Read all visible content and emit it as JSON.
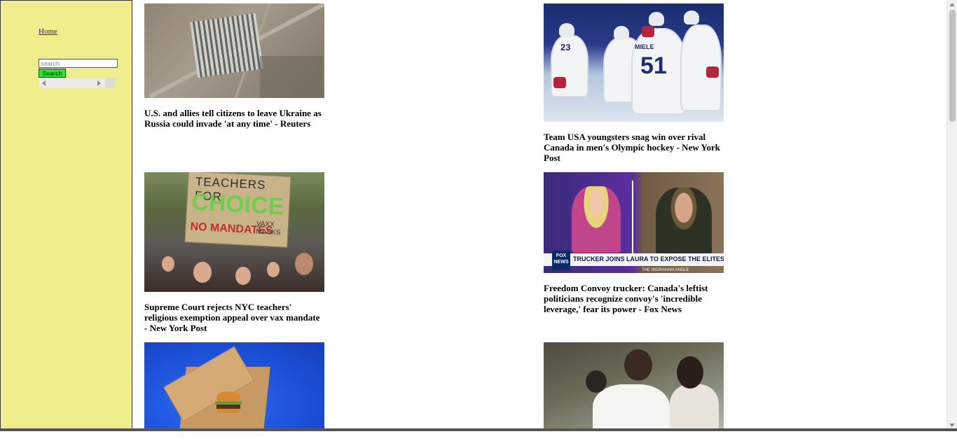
{
  "sidebar": {
    "home_link": "Home",
    "search": {
      "placeholder": "search",
      "button_label": "Search"
    }
  },
  "articles": [
    {
      "headline": "U.S. and allies tell citizens to leave Ukraine as Russia could invade 'at any time' - Reuters"
    },
    {
      "headline": "Team USA youngsters snag win over rival Canada in men's Olympic hockey - New York Post",
      "image_text": {
        "jersey_name": "MIELE",
        "jersey_number_a": "23",
        "jersey_number_b": "51"
      }
    },
    {
      "headline": "Supreme Court rejects NYC teachers' religious exemption appeal over vax mandate - New York Post",
      "image_text": {
        "sign_line1": "TEACHERS FOR",
        "sign_line2": "CHOICE",
        "sign_line3": "NO MANDATES",
        "sign_line4": "VAXX MASKS"
      }
    },
    {
      "headline": "Freedom Convoy trucker: Canada's leftist politicians recognize convoy's 'incredible leverage,' fear its power - Fox News",
      "image_text": {
        "chyron": "TRUCKER JOINS LAURA TO EXPOSE THE ELITES' TYRANNY",
        "logo": "FOX NEWS",
        "show": "THE INGRAHAM ANGLE"
      }
    },
    {
      "headline": ""
    },
    {
      "headline": ""
    }
  ],
  "colors": {
    "sidebar_bg": "#f0ed8c",
    "search_button_bg": "#22ee22",
    "link_visited": "#660099"
  }
}
